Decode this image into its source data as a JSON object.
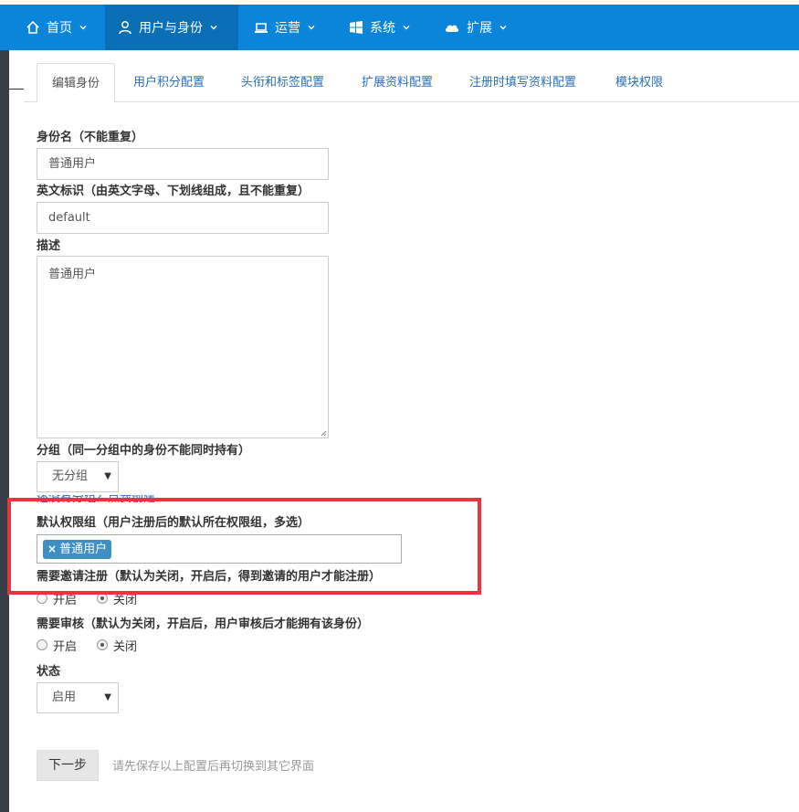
{
  "nav": {
    "items": [
      {
        "label": "首页",
        "icon": "home-icon"
      },
      {
        "label": "用户与身份",
        "icon": "user-icon",
        "active": true
      },
      {
        "label": "运营",
        "icon": "laptop-icon"
      },
      {
        "label": "系统",
        "icon": "windows-icon"
      },
      {
        "label": "扩展",
        "icon": "cloud-icon"
      }
    ]
  },
  "tabs": [
    {
      "label": "编辑身份",
      "active": true
    },
    {
      "label": "用户积分配置"
    },
    {
      "label": "头衔和标签配置"
    },
    {
      "label": "扩展资料配置"
    },
    {
      "label": "注册时填写资料配置"
    },
    {
      "label": "模块权限"
    }
  ],
  "form": {
    "name_label": "身份名（不能重复）",
    "name_value": "普通用户",
    "alias_label": "英文标识（由英文字母、下划线组成，且不能重复）",
    "alias_value": "default",
    "desc_label": "描述",
    "desc_value": "普通用户",
    "group_label": "分组（同一分组中的身份不能同时持有）",
    "group_value": "无分组",
    "group_link": "还没有分组？点我创建",
    "auth_label": "默认权限组（用户注册后的默认所在权限组，多选）",
    "auth_tag": "普通用户",
    "auth_tag_remove": "×",
    "invite_label": "需要邀请注册（默认为关闭，开启后，得到邀请的用户才能注册）",
    "invite_on": "开启",
    "invite_off": "关闭",
    "audit_label": "需要审核（默认为关闭，开启后，用户审核后才能拥有该身份）",
    "audit_on": "开启",
    "audit_off": "关闭",
    "status_label": "状态",
    "status_value": "启用",
    "next_button": "下一步",
    "hint": "请先保存以上配置后再切换到其它界面"
  },
  "colors": {
    "topbar": "#0a85d9",
    "active_nav": "#0a6fb5",
    "highlight": "#e8343a",
    "tag": "#3d8fc4"
  }
}
